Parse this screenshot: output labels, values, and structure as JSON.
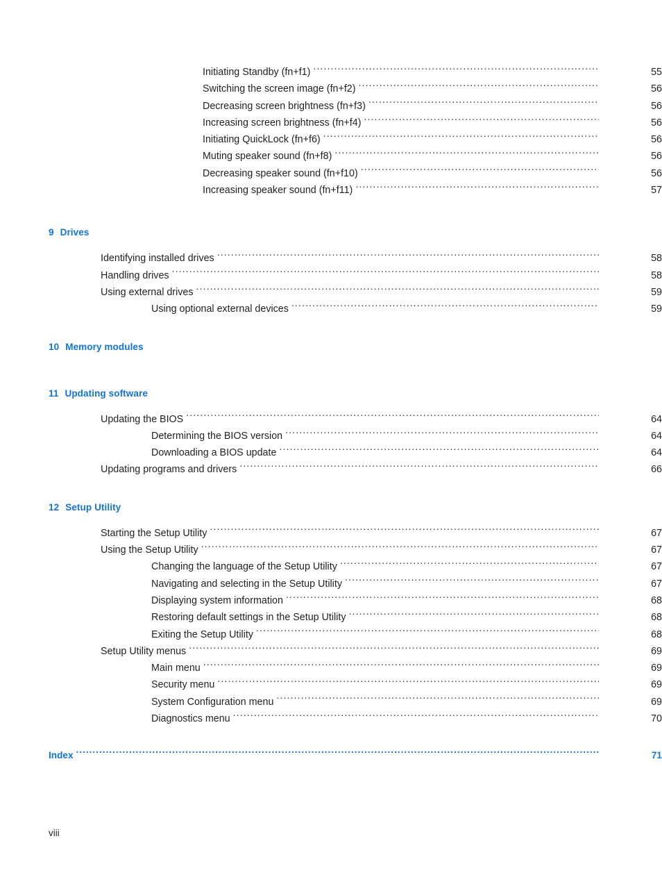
{
  "page": {
    "folio": "viii",
    "heading_color": "#1273dc",
    "text_color": "#231f20",
    "background": "#ffffff"
  },
  "toc": {
    "groups": [
      {
        "id": "hotkeys-continued",
        "heading": null,
        "entries": [
          {
            "level": 3,
            "title": "Initiating Standby (fn+f1)",
            "page": "55"
          },
          {
            "level": 3,
            "title": "Switching the screen image (fn+f2)",
            "page": "56"
          },
          {
            "level": 3,
            "title": "Decreasing screen brightness (fn+f3)",
            "page": "56"
          },
          {
            "level": 3,
            "title": "Increasing screen brightness (fn+f4)",
            "page": "56"
          },
          {
            "level": 3,
            "title": "Initiating QuickLock (fn+f6)",
            "page": "56"
          },
          {
            "level": 3,
            "title": "Muting speaker sound (fn+f8)",
            "page": "56"
          },
          {
            "level": 3,
            "title": "Decreasing speaker sound (fn+f10)",
            "page": "56"
          },
          {
            "level": 3,
            "title": "Increasing speaker sound (fn+f11)",
            "page": "57"
          }
        ]
      },
      {
        "id": "drives",
        "heading": {
          "number": "9",
          "title": "Drives"
        },
        "entries": [
          {
            "level": 1,
            "title": "Identifying installed drives",
            "page": "58"
          },
          {
            "level": 1,
            "title": "Handling drives",
            "page": "58"
          },
          {
            "level": 1,
            "title": "Using external drives",
            "page": "59"
          },
          {
            "level": 2,
            "title": "Using optional external devices",
            "page": "59"
          }
        ]
      },
      {
        "id": "memory-modules",
        "heading": {
          "number": "10",
          "title": "Memory modules"
        },
        "entries": []
      },
      {
        "id": "updating-software",
        "heading": {
          "number": "11",
          "title": "Updating software"
        },
        "entries": [
          {
            "level": 1,
            "title": "Updating the BIOS",
            "page": "64"
          },
          {
            "level": 2,
            "title": "Determining the BIOS version",
            "page": "64"
          },
          {
            "level": 2,
            "title": "Downloading a BIOS update",
            "page": "64"
          },
          {
            "level": 1,
            "title": "Updating programs and drivers",
            "page": "66"
          }
        ]
      },
      {
        "id": "setup-utility",
        "heading": {
          "number": "12",
          "title": "Setup Utility"
        },
        "entries": [
          {
            "level": 1,
            "title": "Starting the Setup Utility",
            "page": "67"
          },
          {
            "level": 1,
            "title": "Using the Setup Utility",
            "page": "67"
          },
          {
            "level": 2,
            "title": "Changing the language of the Setup Utility",
            "page": "67"
          },
          {
            "level": 2,
            "title": "Navigating and selecting in the Setup Utility",
            "page": "67"
          },
          {
            "level": 2,
            "title": "Displaying system information",
            "page": "68"
          },
          {
            "level": 2,
            "title": "Restoring default settings in the Setup Utility",
            "page": "68"
          },
          {
            "level": 2,
            "title": "Exiting the Setup Utility",
            "page": "68"
          },
          {
            "level": 1,
            "title": "Setup Utility menus",
            "page": "69"
          },
          {
            "level": 2,
            "title": "Main menu",
            "page": "69"
          },
          {
            "level": 2,
            "title": "Security menu",
            "page": "69"
          },
          {
            "level": 2,
            "title": "System Configuration menu",
            "page": "69"
          },
          {
            "level": 2,
            "title": "Diagnostics menu",
            "page": "70"
          }
        ]
      }
    ],
    "index": {
      "title": "Index",
      "page": "71"
    }
  }
}
